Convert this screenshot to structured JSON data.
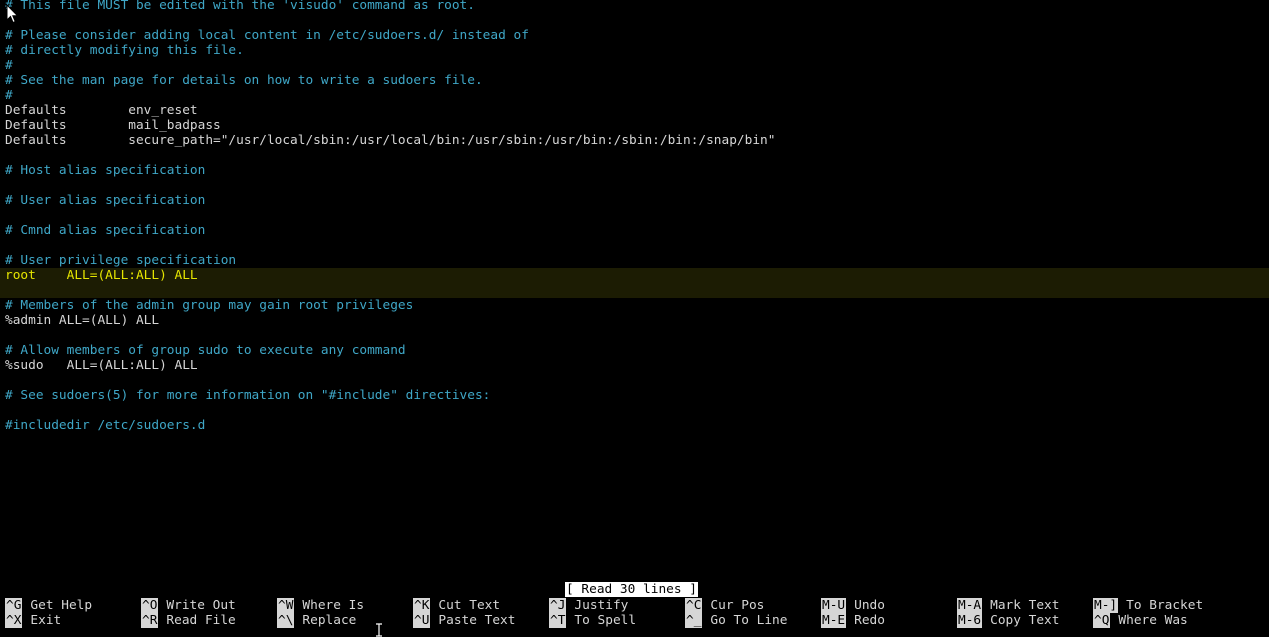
{
  "editor": {
    "lines": [
      {
        "text": "# This file MUST be edited with the 'visudo' command as root.",
        "kind": "comment"
      },
      {
        "text": "",
        "kind": "normal"
      },
      {
        "text": "# Please consider adding local content in /etc/sudoers.d/ instead of",
        "kind": "comment"
      },
      {
        "text": "# directly modifying this file.",
        "kind": "comment"
      },
      {
        "text": "#",
        "kind": "comment"
      },
      {
        "text": "# See the man page for details on how to write a sudoers file.",
        "kind": "comment"
      },
      {
        "text": "#",
        "kind": "comment"
      },
      {
        "text": "Defaults        env_reset",
        "kind": "normal"
      },
      {
        "text": "Defaults        mail_badpass",
        "kind": "normal"
      },
      {
        "text": "Defaults        secure_path=\"/usr/local/sbin:/usr/local/bin:/usr/sbin:/usr/bin:/sbin:/bin:/snap/bin\"",
        "kind": "normal"
      },
      {
        "text": "",
        "kind": "normal"
      },
      {
        "text": "# Host alias specification",
        "kind": "comment"
      },
      {
        "text": "",
        "kind": "normal"
      },
      {
        "text": "# User alias specification",
        "kind": "comment"
      },
      {
        "text": "",
        "kind": "normal"
      },
      {
        "text": "# Cmnd alias specification",
        "kind": "comment"
      },
      {
        "text": "",
        "kind": "normal"
      },
      {
        "text": "# User privilege specification",
        "kind": "comment"
      },
      {
        "text": "root    ALL=(ALL:ALL) ALL",
        "kind": "current"
      },
      {
        "text": "",
        "kind": "current"
      },
      {
        "text": "# Members of the admin group may gain root privileges",
        "kind": "comment"
      },
      {
        "text": "%admin ALL=(ALL) ALL",
        "kind": "normal"
      },
      {
        "text": "",
        "kind": "normal"
      },
      {
        "text": "# Allow members of group sudo to execute any command",
        "kind": "comment"
      },
      {
        "text": "%sudo   ALL=(ALL:ALL) ALL",
        "kind": "normal"
      },
      {
        "text": "",
        "kind": "normal"
      },
      {
        "text": "# See sudoers(5) for more information on \"#include\" directives:",
        "kind": "comment"
      },
      {
        "text": "",
        "kind": "normal"
      },
      {
        "text": "#includedir /etc/sudoers.d",
        "kind": "comment"
      }
    ]
  },
  "status_message": "[ Read 30 lines ]",
  "shortcuts": [
    {
      "key": "^G",
      "label": "Get Help",
      "col": 0,
      "row": 0
    },
    {
      "key": "^X",
      "label": "Exit",
      "col": 0,
      "row": 1
    },
    {
      "key": "^O",
      "label": "Write Out",
      "col": 1,
      "row": 0
    },
    {
      "key": "^R",
      "label": "Read File",
      "col": 1,
      "row": 1
    },
    {
      "key": "^W",
      "label": "Where Is",
      "col": 2,
      "row": 0
    },
    {
      "key": "^\\",
      "label": "Replace",
      "col": 2,
      "row": 1
    },
    {
      "key": "^K",
      "label": "Cut Text",
      "col": 3,
      "row": 0
    },
    {
      "key": "^U",
      "label": "Paste Text",
      "col": 3,
      "row": 1
    },
    {
      "key": "^J",
      "label": "Justify",
      "col": 4,
      "row": 0
    },
    {
      "key": "^T",
      "label": "To Spell",
      "col": 4,
      "row": 1
    },
    {
      "key": "^C",
      "label": "Cur Pos",
      "col": 5,
      "row": 0
    },
    {
      "key": "^_",
      "label": "Go To Line",
      "col": 5,
      "row": 1
    },
    {
      "key": "M-U",
      "label": "Undo",
      "col": 6,
      "row": 0
    },
    {
      "key": "M-E",
      "label": "Redo",
      "col": 6,
      "row": 1
    },
    {
      "key": "M-A",
      "label": "Mark Text",
      "col": 7,
      "row": 0
    },
    {
      "key": "M-6",
      "label": "Copy Text",
      "col": 7,
      "row": 1
    },
    {
      "key": "M-]",
      "label": "To Bracket",
      "col": 8,
      "row": 0
    },
    {
      "key": "^Q",
      "label": "Where Was",
      "col": 8,
      "row": 1
    }
  ],
  "colors": {
    "background": "#000000",
    "comment": "#3fa7c7",
    "text": "#d6d6d6",
    "current_line_bg": "#1c1c03",
    "current_line_text": "#e6e600"
  }
}
